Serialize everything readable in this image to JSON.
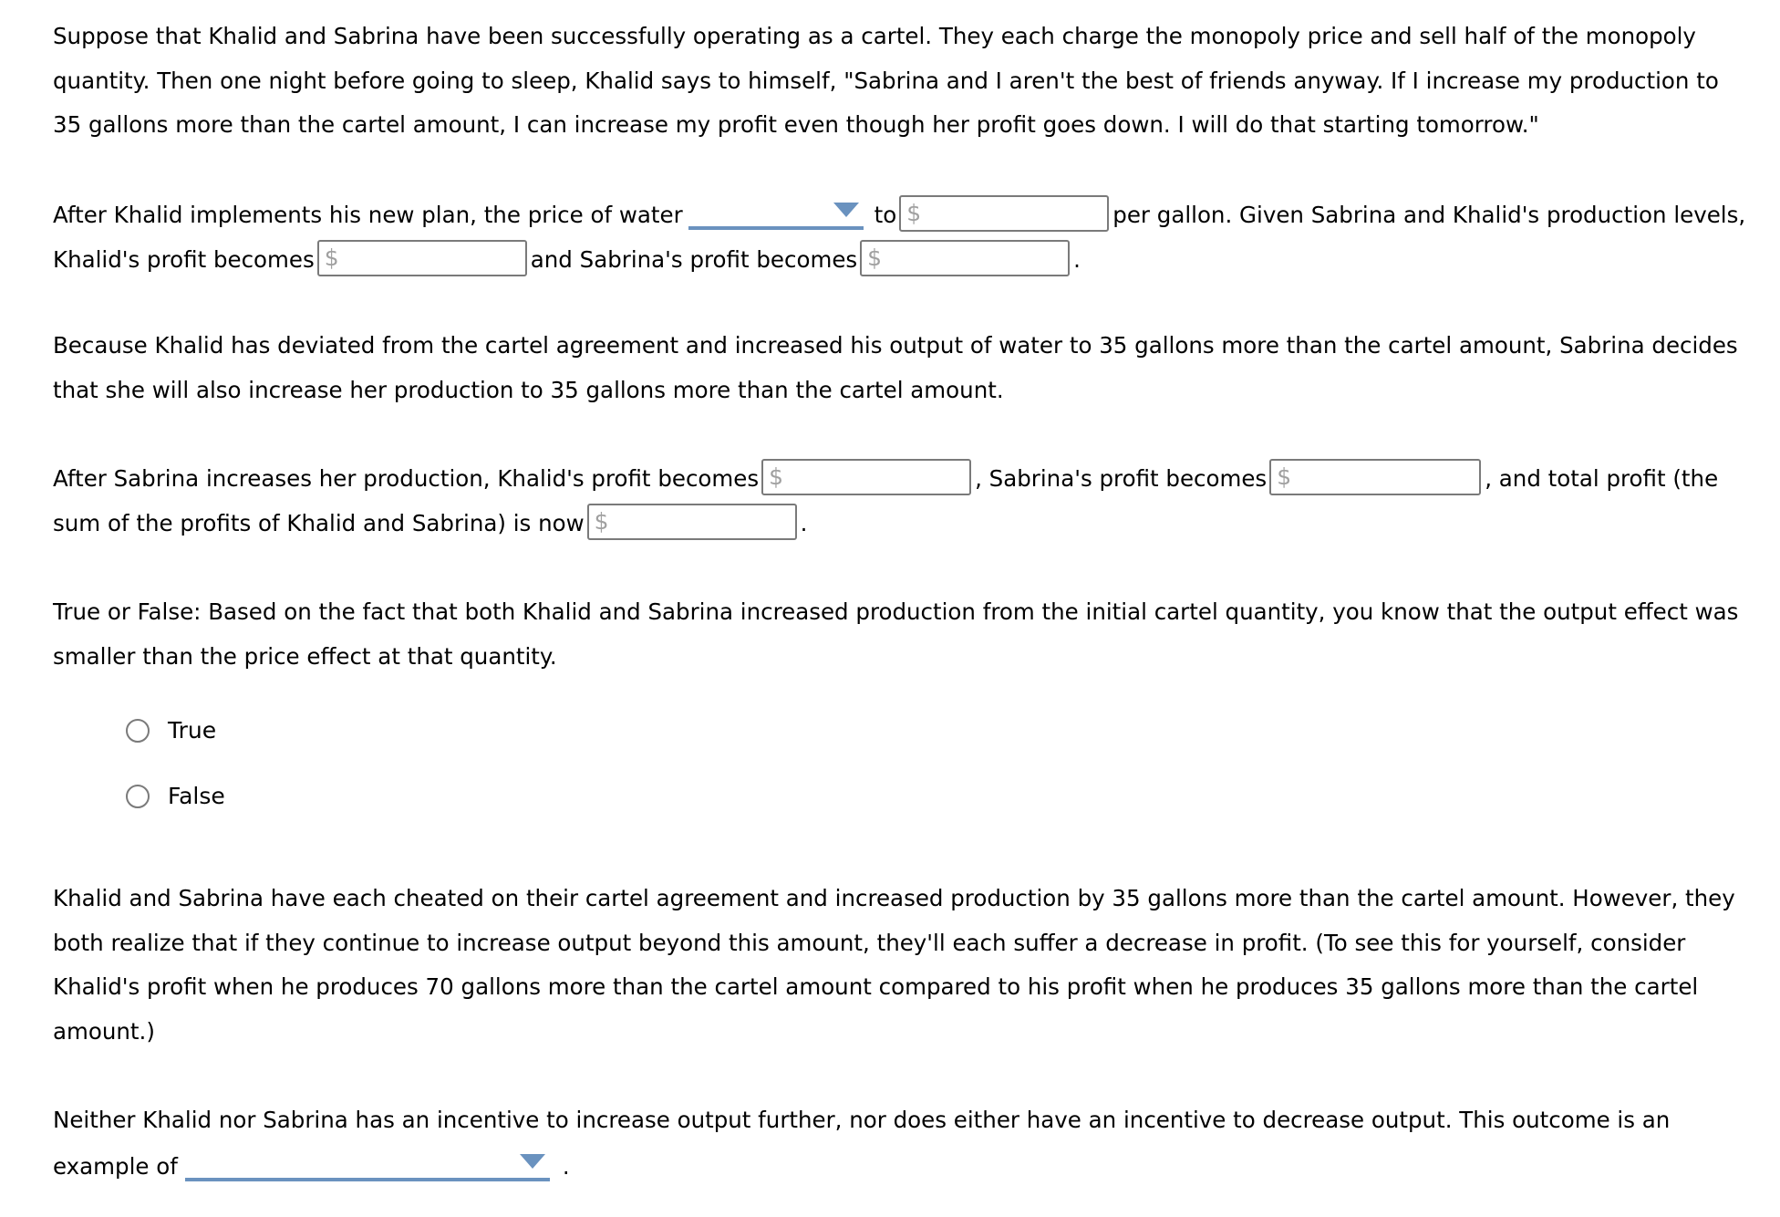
{
  "intro": {
    "text": "Suppose that Khalid and Sabrina have been successfully operating as a cartel. They each charge the monopoly price and sell half of the monopoly quantity. Then one night before going to sleep, Khalid says to himself, \"Sabrina and I aren't the best of friends anyway. If I increase my production to 35 gallons more than the cartel amount, I can increase my profit even though her profit goes down. I will do that starting tomorrow.\""
  },
  "q1": {
    "t1": "After Khalid implements his new plan, the price of water",
    "price_direction_selected": "",
    "t2": "to",
    "t3": "per gallon. Given Sabrina and Khalid's production levels, Khalid's profit becomes",
    "t4": "and Sabrina's profit becomes",
    "t5": ".",
    "currency_symbol": "$",
    "price_value": "",
    "khalid_profit_value": "",
    "sabrina_profit_value": ""
  },
  "context2": {
    "text": "Because Khalid has deviated from the cartel agreement and increased his output of water to 35 gallons more than the cartel amount, Sabrina decides that she will also increase her production to 35 gallons more than the cartel amount."
  },
  "q2": {
    "t1": "After Sabrina increases her production, Khalid's profit becomes",
    "t2": ", Sabrina's profit becomes",
    "t3": ", and total profit (the sum of the profits of Khalid and Sabrina) is now",
    "t4": ".",
    "currency_symbol": "$",
    "khalid_profit_value": "",
    "sabrina_profit_value": "",
    "total_profit_value": ""
  },
  "q3": {
    "prompt": "True or False: Based on the fact that both Khalid and Sabrina increased production from the initial cartel quantity, you know that the output effect was smaller than the price effect at that quantity.",
    "options": [
      {
        "label": "True",
        "selected": false
      },
      {
        "label": "False",
        "selected": false
      }
    ]
  },
  "context3": {
    "text": "Khalid and Sabrina have each cheated on their cartel agreement and increased production by 35 gallons more than the cartel amount. However, they both realize that if they continue to increase output beyond this amount, they'll each suffer a decrease in profit. (To see this for yourself, consider Khalid's profit when he produces 70 gallons more than the cartel amount compared to his profit when he produces 35 gallons more than the cartel amount.)"
  },
  "q4": {
    "t1": "Neither Khalid nor Sabrina has an incentive to increase output further, nor does either have an incentive to decrease output. This outcome is an example of",
    "selected": "",
    "t2": "."
  },
  "colors": {
    "dropdown_accent": "#6a92bf",
    "input_border": "#7a7a7a",
    "currency_symbol": "#a0a0a0",
    "text": "#000000"
  }
}
